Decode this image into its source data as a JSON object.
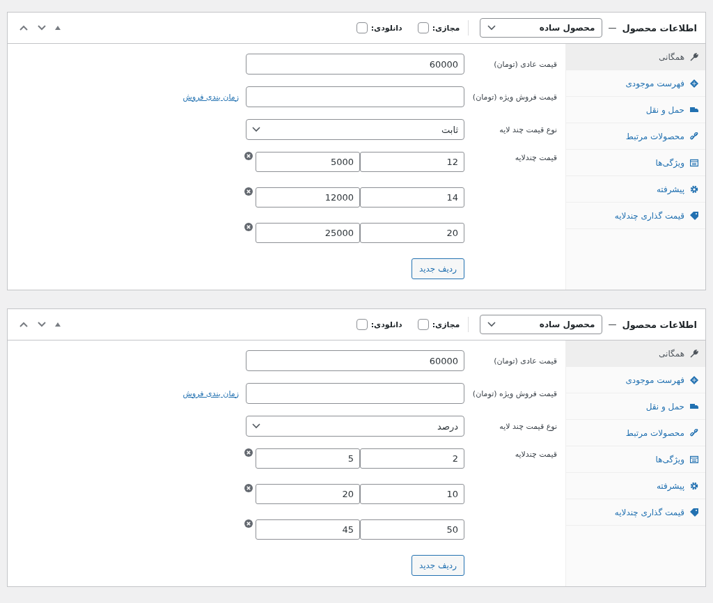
{
  "panels": [
    {
      "title": "اطلاعات محصول",
      "dash": "—",
      "product_type": "محصول ساده",
      "virtual": {
        "label": "مجازی:",
        "checked": false
      },
      "downloadable": {
        "label": "دانلودی:",
        "checked": false
      },
      "tabs": [
        {
          "label": "همگانی",
          "selected": true
        },
        {
          "label": "فهرست موجودی",
          "selected": false
        },
        {
          "label": "حمل و نقل",
          "selected": false
        },
        {
          "label": "محصولات مرتبط",
          "selected": false
        },
        {
          "label": "ویژگی‌ها",
          "selected": false
        },
        {
          "label": "پیشرفته",
          "selected": false
        },
        {
          "label": "قیمت گذاری چندلایه",
          "selected": false
        }
      ],
      "regular_price": {
        "label": "قیمت عادی (تومان)",
        "value": "60000"
      },
      "sale_price": {
        "label": "قیمت فروش ویژه (تومان)",
        "link": "زمان بندی فروش"
      },
      "tier_type": {
        "label": "نوع قیمت چند لایه",
        "value": "ثابت"
      },
      "tiers_label": "قیمت چندلایه",
      "tiers": [
        {
          "quantity": "12",
          "price": "5000"
        },
        {
          "quantity": "14",
          "price": "12000"
        },
        {
          "quantity": "20",
          "price": "25000"
        }
      ],
      "add_button": "ردیف جدید"
    },
    {
      "title": "اطلاعات محصول",
      "dash": "—",
      "product_type": "محصول ساده",
      "virtual": {
        "label": "مجازی:",
        "checked": false
      },
      "downloadable": {
        "label": "دانلودی:",
        "checked": false
      },
      "tabs": [
        {
          "label": "همگانی",
          "selected": true
        },
        {
          "label": "فهرست موجودی",
          "selected": false
        },
        {
          "label": "حمل و نقل",
          "selected": false
        },
        {
          "label": "محصولات مرتبط",
          "selected": false
        },
        {
          "label": "ویژگی‌ها",
          "selected": false
        },
        {
          "label": "پیشرفته",
          "selected": false
        },
        {
          "label": "قیمت گذاری چندلایه",
          "selected": false
        }
      ],
      "regular_price": {
        "label": "قیمت عادی (تومان)",
        "value": "60000"
      },
      "sale_price": {
        "label": "قیمت فروش ویژه (تومان)",
        "link": "زمان بندی فروش"
      },
      "tier_type": {
        "label": "نوع قیمت چند لایه",
        "value": "درصد"
      },
      "tiers_label": "قیمت چندلایه",
      "tiers": [
        {
          "quantity": "2",
          "price": "5"
        },
        {
          "quantity": "10",
          "price": "20"
        },
        {
          "quantity": "50",
          "price": "45"
        }
      ],
      "add_button": "ردیف جدید"
    }
  ]
}
